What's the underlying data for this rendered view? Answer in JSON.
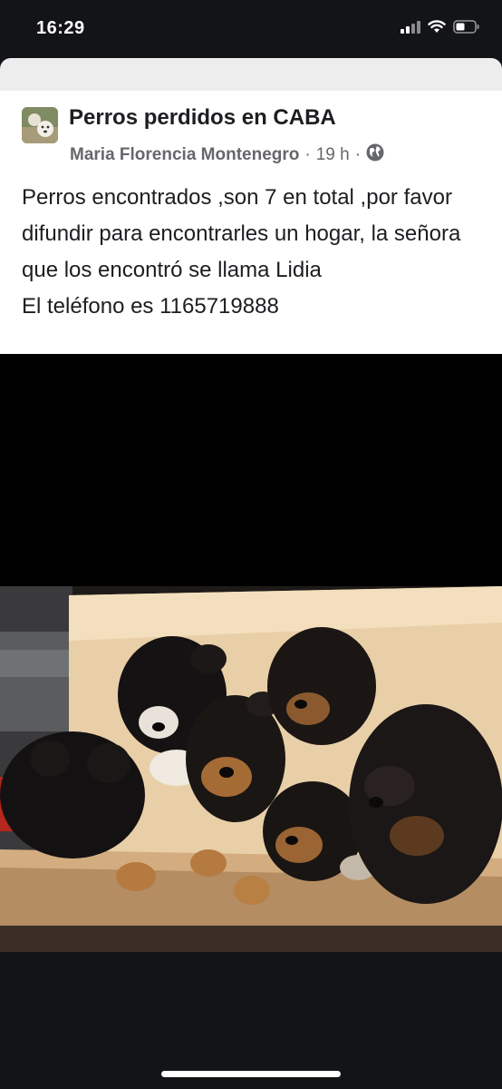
{
  "status_bar": {
    "time": "16:29",
    "icons": [
      "cellular-signal-icon",
      "wifi-icon",
      "battery-icon"
    ]
  },
  "post": {
    "group_name": "Perros perdidos en CABA",
    "author": "Maria Florencia Montenegro",
    "separator": "·",
    "time_ago": "19 h",
    "privacy_icon": "globe-icon",
    "text": "Perros encontrados ,son 7 en total ,por favor difundir para encontrarles un hogar, la señora que los encontró se llama Lidia\nEl teléfono es 1165719888"
  },
  "photo": {
    "subject": "puppies-in-cardboard-box"
  },
  "colors": {
    "background": "#131417",
    "card": "#ffffff",
    "text_primary": "#1c1e21",
    "text_secondary": "#65676b"
  }
}
